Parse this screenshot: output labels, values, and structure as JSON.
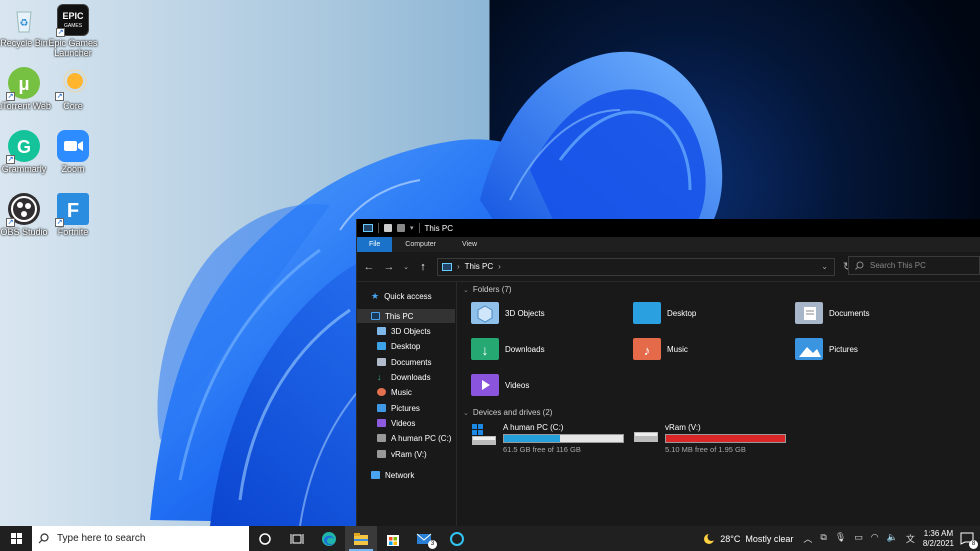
{
  "desktop_icons": [
    {
      "label": "Recycle Bin",
      "icon": "recycle-bin-icon"
    },
    {
      "label": "Epic Games Launcher",
      "icon": "epic-games-icon",
      "logo_text": "EPIC GAMES"
    },
    {
      "label": "uTorrent Web",
      "icon": "utorrent-icon"
    },
    {
      "label": "Core",
      "icon": "core-icon"
    },
    {
      "label": "Grammarly",
      "icon": "grammarly-icon"
    },
    {
      "label": "Zoom",
      "icon": "zoom-icon"
    },
    {
      "label": "OBS Studio",
      "icon": "obs-icon"
    },
    {
      "label": "Fortnite",
      "icon": "fortnite-icon"
    }
  ],
  "explorer": {
    "title": "This PC",
    "ribbon_tabs": [
      "File",
      "Computer",
      "View"
    ],
    "address": "This PC",
    "search_placeholder": "Search This PC",
    "sidebar": [
      {
        "label": "Quick access",
        "icon": "star-icon",
        "color": "#4aa3f0"
      },
      {
        "label": "This PC",
        "icon": "pc-icon",
        "color": "#4aa3f0"
      },
      {
        "label": "3D Objects",
        "icon": "cube-icon",
        "color": "#7fb8e8"
      },
      {
        "label": "Desktop",
        "icon": "desktop-folder-icon",
        "color": "#3ba3e6"
      },
      {
        "label": "Documents",
        "icon": "documents-icon",
        "color": "#b0bccb"
      },
      {
        "label": "Downloads",
        "icon": "download-icon",
        "color": "#2eb07e"
      },
      {
        "label": "Music",
        "icon": "music-icon",
        "color": "#e2704f"
      },
      {
        "label": "Pictures",
        "icon": "pictures-icon",
        "color": "#3f98e3"
      },
      {
        "label": "Videos",
        "icon": "videos-icon",
        "color": "#8e5be0"
      },
      {
        "label": "A human PC (C:)",
        "icon": "drive-icon",
        "color": "#999999"
      },
      {
        "label": "vRam (V:)",
        "icon": "drive-icon",
        "color": "#999999"
      },
      {
        "label": "Network",
        "icon": "network-icon",
        "color": "#4aa3f0"
      }
    ],
    "folders_header": "Folders (7)",
    "folders": [
      {
        "label": "3D Objects",
        "color": "#8fc1ea"
      },
      {
        "label": "Desktop",
        "color": "#2aa0e0"
      },
      {
        "label": "Documents",
        "color": "#a7b6c8"
      },
      {
        "label": "Downloads",
        "color": "#25a872"
      },
      {
        "label": "Music",
        "color": "#e56a4a"
      },
      {
        "label": "Pictures",
        "color": "#3a94e0"
      },
      {
        "label": "Videos",
        "color": "#8a54dd"
      }
    ],
    "drives_header": "Devices and drives (2)",
    "drives": [
      {
        "label": "A human PC (C:)",
        "free": "61.5 GB free of 116 GB",
        "used_fraction": 0.47,
        "bar_color": "#26a0da"
      },
      {
        "label": "vRam (V:)",
        "free": "5.10 MB free of 1.95 GB",
        "used_fraction": 0.997,
        "bar_color": "#da2626"
      }
    ]
  },
  "taskbar": {
    "search_placeholder": "Type here to search",
    "apps": [
      "cortana-icon",
      "task-view-icon",
      "edge-icon",
      "file-explorer-icon",
      "store-icon",
      "mail-icon",
      "alexa-icon"
    ],
    "mail_badge": "3",
    "weather": "28°C  Mostly clear",
    "time": "1:36 AM",
    "date": "8/2/2021",
    "notification_count": "8"
  }
}
